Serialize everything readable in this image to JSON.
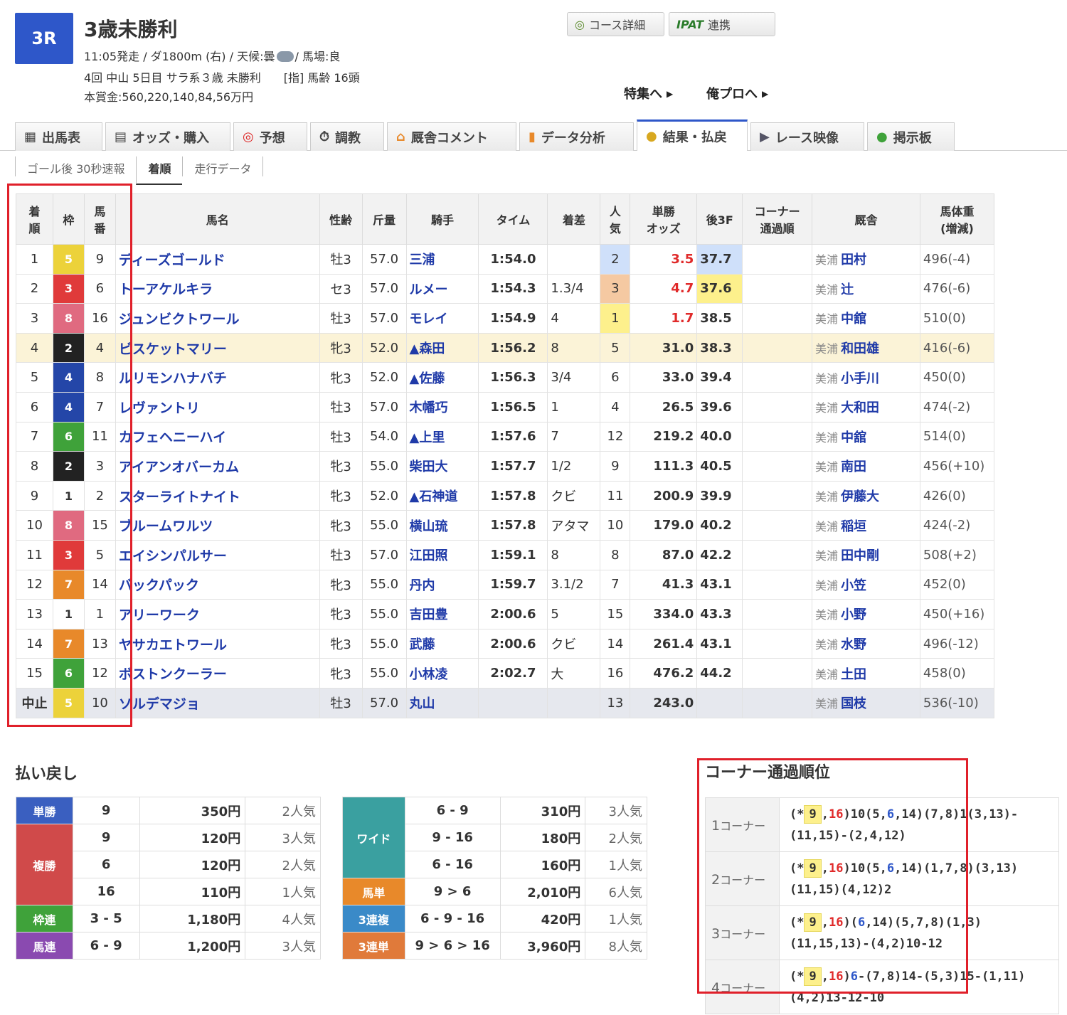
{
  "race": {
    "no": "3R",
    "title": "3歳未勝利",
    "line1_a": "11:05発走 / ダ1800m (右) / 天候:曇",
    "line1_b": "/ 馬場:良",
    "line2": "4回 中山 5日目 サラ系３歳 未勝利　　[指] 馬齢 16頭",
    "line3": "本賞金:560,220,140,84,56万円"
  },
  "buttons": {
    "course": "コース詳細",
    "ipat_logo": "IPAT",
    "ipat": "連携"
  },
  "links": {
    "tokushu": "特集へ",
    "orepro": "俺プロへ"
  },
  "tabs": [
    "出馬表",
    "オッズ・購入",
    "予想",
    "調教",
    "厩舎コメント",
    "データ分析",
    "結果・払戻",
    "レース映像",
    "掲示板"
  ],
  "subtabs": [
    "ゴール後 30秒速報",
    "着順",
    "走行データ"
  ],
  "headers": {
    "rank": [
      "着",
      "順"
    ],
    "waku": "枠",
    "umaban": [
      "馬",
      "番"
    ],
    "name": "馬名",
    "sexage": "性齢",
    "kinryo": "斤量",
    "jockey": "騎手",
    "time": "タイム",
    "margin": "着差",
    "pop": [
      "人",
      "気"
    ],
    "odds": [
      "単勝",
      "オッズ"
    ],
    "f3": "後3F",
    "corner": [
      "コーナー",
      "通過順"
    ],
    "trainer": "厩舎",
    "weight": [
      "馬体重",
      "(増減)"
    ]
  },
  "results": [
    [
      "1",
      "5",
      "9",
      "ディーズゴールド",
      "牡3",
      "57.0",
      "三浦",
      "1:54.0",
      "",
      "2",
      "3.5",
      "37.7",
      "",
      "美浦",
      "田村",
      "496(-4)"
    ],
    [
      "2",
      "3",
      "6",
      "トーアケルキラ",
      "セ3",
      "57.0",
      "ルメー",
      "1:54.3",
      "1.3/4",
      "3",
      "4.7",
      "37.6",
      "",
      "美浦",
      "辻",
      "476(-6)"
    ],
    [
      "3",
      "8",
      "16",
      "ジュンビクトワール",
      "牡3",
      "57.0",
      "モレイ",
      "1:54.9",
      "4",
      "1",
      "1.7",
      "38.5",
      "",
      "美浦",
      "中舘",
      "510(0)"
    ],
    [
      "4",
      "2",
      "4",
      "ビスケットマリー",
      "牝3",
      "52.0",
      "▲森田",
      "1:56.2",
      "8",
      "5",
      "31.0",
      "38.3",
      "",
      "美浦",
      "和田雄",
      "416(-6)"
    ],
    [
      "5",
      "4",
      "8",
      "ルリモンハナバチ",
      "牝3",
      "52.0",
      "▲佐藤",
      "1:56.3",
      "3/4",
      "6",
      "33.0",
      "39.4",
      "",
      "美浦",
      "小手川",
      "450(0)"
    ],
    [
      "6",
      "4",
      "7",
      "レヴァントリ",
      "牡3",
      "57.0",
      "木幡巧",
      "1:56.5",
      "1",
      "4",
      "26.5",
      "39.6",
      "",
      "美浦",
      "大和田",
      "474(-2)"
    ],
    [
      "7",
      "6",
      "11",
      "カフェヘニーハイ",
      "牡3",
      "54.0",
      "▲上里",
      "1:57.6",
      "7",
      "12",
      "219.2",
      "40.0",
      "",
      "美浦",
      "中舘",
      "514(0)"
    ],
    [
      "8",
      "2",
      "3",
      "アイアンオバーカム",
      "牝3",
      "55.0",
      "柴田大",
      "1:57.7",
      "1/2",
      "9",
      "111.3",
      "40.5",
      "",
      "美浦",
      "南田",
      "456(+10)"
    ],
    [
      "9",
      "1",
      "2",
      "スターライトナイト",
      "牝3",
      "52.0",
      "▲石神道",
      "1:57.8",
      "クビ",
      "11",
      "200.9",
      "39.9",
      "",
      "美浦",
      "伊藤大",
      "426(0)"
    ],
    [
      "10",
      "8",
      "15",
      "ブルームワルツ",
      "牝3",
      "55.0",
      "横山琉",
      "1:57.8",
      "アタマ",
      "10",
      "179.0",
      "40.2",
      "",
      "美浦",
      "稲垣",
      "424(-2)"
    ],
    [
      "11",
      "3",
      "5",
      "エイシンパルサー",
      "牡3",
      "57.0",
      "江田照",
      "1:59.1",
      "8",
      "8",
      "87.0",
      "42.2",
      "",
      "美浦",
      "田中剛",
      "508(+2)"
    ],
    [
      "12",
      "7",
      "14",
      "バックパック",
      "牝3",
      "55.0",
      "丹内",
      "1:59.7",
      "3.1/2",
      "7",
      "41.3",
      "43.1",
      "",
      "美浦",
      "小笠",
      "452(0)"
    ],
    [
      "13",
      "1",
      "1",
      "アリーワーク",
      "牝3",
      "55.0",
      "吉田豊",
      "2:00.6",
      "5",
      "15",
      "334.0",
      "43.3",
      "",
      "美浦",
      "小野",
      "450(+16)"
    ],
    [
      "14",
      "7",
      "13",
      "ヤサカエトワール",
      "牝3",
      "55.0",
      "武藤",
      "2:00.6",
      "クビ",
      "14",
      "261.4",
      "43.1",
      "",
      "美浦",
      "水野",
      "496(-12)"
    ],
    [
      "15",
      "6",
      "12",
      "ボストンクーラー",
      "牝3",
      "55.0",
      "小林凌",
      "2:02.7",
      "大",
      "16",
      "476.2",
      "44.2",
      "",
      "美浦",
      "土田",
      "458(0)"
    ],
    [
      "中止",
      "5",
      "10",
      "ソルデマジョ",
      "牡3",
      "57.0",
      "丸山",
      "",
      "",
      "13",
      "243.0",
      "",
      "",
      "美浦",
      "国枝",
      "536(-10)"
    ]
  ],
  "waku_colors": {
    "1": [
      "#ffffff",
      "#333333"
    ],
    "2": [
      "#222222",
      "#ffffff"
    ],
    "3": [
      "#e03a3a",
      "#ffffff"
    ],
    "4": [
      "#2446a8",
      "#ffffff"
    ],
    "5": [
      "#ecd23a",
      "#ffffff"
    ],
    "6": [
      "#3fa23a",
      "#ffffff"
    ],
    "7": [
      "#e8892a",
      "#ffffff"
    ],
    "8": [
      "#e06a80",
      "#ffffff"
    ]
  },
  "payout_title": "払い戻し",
  "payout_left": [
    {
      "label": "単勝",
      "color": "#3a5fc0",
      "rows": [
        [
          "9",
          "350円",
          "2人気"
        ]
      ]
    },
    {
      "label": "複勝",
      "color": "#d04a4a",
      "rows": [
        [
          "9",
          "120円",
          "3人気"
        ],
        [
          "6",
          "120円",
          "2人気"
        ],
        [
          "16",
          "110円",
          "1人気"
        ]
      ]
    },
    {
      "label": "枠連",
      "color": "#3fa23a",
      "rows": [
        [
          "3 - 5",
          "1,180円",
          "4人気"
        ]
      ]
    },
    {
      "label": "馬連",
      "color": "#8a4ab0",
      "rows": [
        [
          "6 - 9",
          "1,200円",
          "3人気"
        ]
      ]
    }
  ],
  "payout_right": [
    {
      "label": "ワイド",
      "color": "#3aa0a0",
      "rows": [
        [
          "6 - 9",
          "310円",
          "3人気"
        ],
        [
          "9 - 16",
          "180円",
          "2人気"
        ],
        [
          "6 - 16",
          "160円",
          "1人気"
        ]
      ]
    },
    {
      "label": "馬単",
      "color": "#e8892a",
      "rows": [
        [
          "9 > 6",
          "2,010円",
          "6人気"
        ]
      ]
    },
    {
      "label": "3連複",
      "color": "#3a8ac8",
      "rows": [
        [
          "6 - 9 - 16",
          "420円",
          "1人気"
        ]
      ]
    },
    {
      "label": "3連単",
      "color": "#e07a3a",
      "rows": [
        [
          "9 > 6 > 16",
          "3,960円",
          "8人気"
        ]
      ]
    }
  ],
  "corner_title": "コーナー通過順位",
  "corners": [
    {
      "label_num": "1",
      "label": "コーナー",
      "parts": [
        [
          "t",
          "(*"
        ],
        [
          "y",
          "9"
        ],
        [
          "t",
          ","
        ],
        [
          "r",
          "16"
        ],
        [
          "t",
          ")10(5,"
        ],
        [
          "b",
          "6"
        ],
        [
          "t",
          ",14)(7,8)1(3,13)-(11,15)-(2,4,12)"
        ]
      ]
    },
    {
      "label_num": "2",
      "label": "コーナー",
      "parts": [
        [
          "t",
          "(*"
        ],
        [
          "y",
          "9"
        ],
        [
          "t",
          ","
        ],
        [
          "r",
          "16"
        ],
        [
          "t",
          ")10(5,"
        ],
        [
          "b",
          "6"
        ],
        [
          "t",
          ",14)(1,7,8)(3,13)(11,15)(4,12)2"
        ]
      ]
    },
    {
      "label_num": "3",
      "label": "コーナー",
      "parts": [
        [
          "t",
          "(*"
        ],
        [
          "y",
          "9"
        ],
        [
          "t",
          ","
        ],
        [
          "r",
          "16"
        ],
        [
          "t",
          ")("
        ],
        [
          "b",
          "6"
        ],
        [
          "t",
          ",14)(5,7,8)(1,3)(11,15,13)-(4,2)10-12"
        ]
      ]
    },
    {
      "label_num": "4",
      "label": "コーナー",
      "parts": [
        [
          "t",
          "(*"
        ],
        [
          "y",
          "9"
        ],
        [
          "t",
          ","
        ],
        [
          "r",
          "16"
        ],
        [
          "t",
          ")"
        ],
        [
          "b",
          "6"
        ],
        [
          "t",
          "-(7,8)14-(5,3)15-(1,11)(4,2)13-12-10"
        ]
      ]
    }
  ]
}
